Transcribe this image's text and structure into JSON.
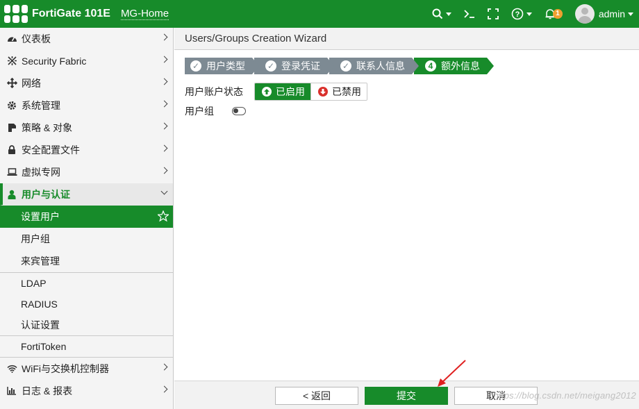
{
  "topbar": {
    "product": "FortiGate 101E",
    "hostname": "MG-Home",
    "user": "admin",
    "notification_count": "1",
    "icons": [
      "search-icon",
      "cli-console-icon",
      "fullscreen-icon",
      "help-icon",
      "bell-icon"
    ],
    "accent_color": "#178b2a"
  },
  "sidebar": {
    "items": [
      {
        "label": "仪表板",
        "icon": "dashboard-icon"
      },
      {
        "label": "Security Fabric",
        "icon": "security-fabric-icon"
      },
      {
        "label": "网络",
        "icon": "network-icon"
      },
      {
        "label": "系统管理",
        "icon": "gear-icon"
      },
      {
        "label": "策略 & 对象",
        "icon": "policy-icon"
      },
      {
        "label": "安全配置文件",
        "icon": "lock-icon"
      },
      {
        "label": "虚拟专网",
        "icon": "laptop-icon"
      },
      {
        "label": "用户与认证",
        "icon": "user-icon"
      }
    ],
    "sub_items": {
      "group1": [
        "设置用户",
        "用户组",
        "来宾管理"
      ],
      "group2": [
        "LDAP",
        "RADIUS",
        "认证设置"
      ],
      "group3": [
        "FortiToken"
      ]
    },
    "bottom_items": [
      {
        "label": "WiFi与交换机控制器",
        "icon": "wifi-icon"
      },
      {
        "label": "日志 & 报表",
        "icon": "chart-icon"
      }
    ]
  },
  "content": {
    "title": "Users/Groups Creation Wizard",
    "steps": [
      {
        "label": "用户类型",
        "state": "done"
      },
      {
        "label": "登录凭证",
        "state": "done"
      },
      {
        "label": "联系人信息",
        "state": "done"
      },
      {
        "label": "额外信息",
        "state": "current",
        "number": "4"
      }
    ],
    "account_status_label": "用户账户状态",
    "enabled_label": "已启用",
    "disabled_label": "已禁用",
    "user_group_label": "用户组",
    "user_group_enabled": false
  },
  "footer": {
    "back_label": "< 返回",
    "submit_label": "提交",
    "cancel_label": "取消",
    "watermark": "https://blog.csdn.net/meigang2012"
  }
}
